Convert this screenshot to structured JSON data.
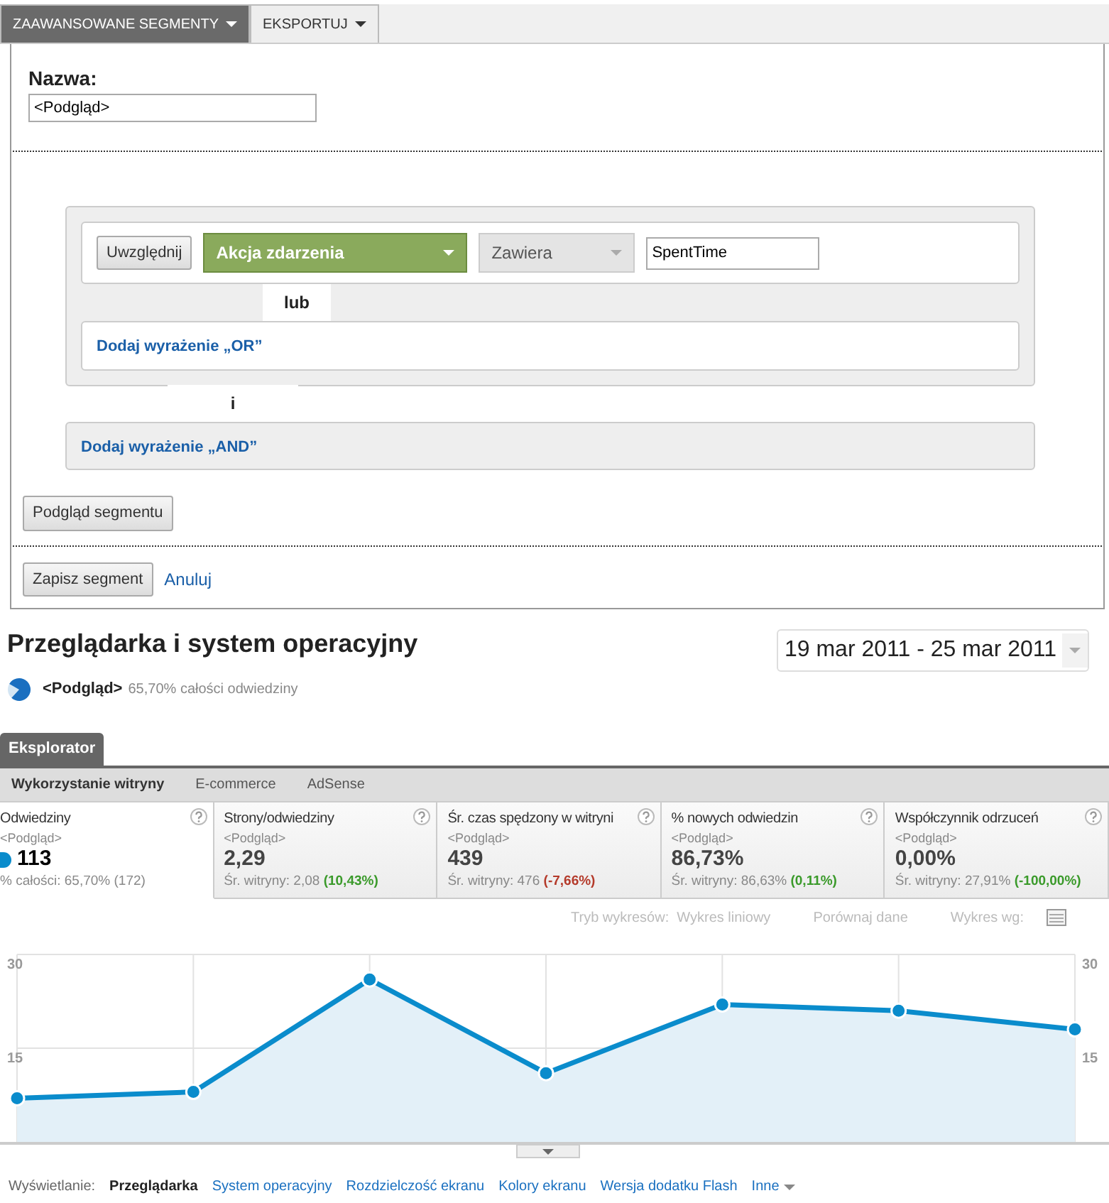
{
  "top_tabs": [
    {
      "label": "ZAAWANSOWANE SEGMENTY",
      "selected": true
    },
    {
      "label": "EKSPORTUJ",
      "selected": false
    }
  ],
  "segment_editor": {
    "name_label": "Nazwa:",
    "name_value": "<Podgląd>",
    "condition": {
      "include_button": "Uwzględnij",
      "dimension": "Akcja zdarzenia",
      "operator": "Zawiera",
      "value": "SpentTime"
    },
    "or_tab": "lub",
    "add_or": "Dodaj wyrażenie „OR”",
    "and_tab": "i",
    "add_and": "Dodaj wyrażenie „AND”",
    "preview_button": "Podgląd segmentu",
    "save_button": "Zapisz segment",
    "cancel_link": "Anuluj"
  },
  "report": {
    "title": "Przeglądarka i system operacyjny",
    "date_range": "19 mar 2011 - 25 mar 2011",
    "segment_name": "<Podgląd>",
    "segment_share": "65,70% całości odwiedziny"
  },
  "explorer_tab": "Eksplorator",
  "sub_tabs": [
    {
      "label": "Wykorzystanie witryny",
      "selected": true
    },
    {
      "label": "E-commerce",
      "selected": false
    },
    {
      "label": "AdSense",
      "selected": false
    }
  ],
  "metrics": [
    {
      "title": "Odwiedziny",
      "segment": "<Podgląd>",
      "value": "113",
      "footer": "% całości: 65,70% (172)",
      "selected": true
    },
    {
      "title": "Strony/odwiedziny",
      "segment": "<Podgląd>",
      "value": "2,29",
      "footer": "Śr. witryny: 2,08",
      "change": {
        "text": "(10,43%)",
        "color": "#3a9a2a"
      },
      "selected": false
    },
    {
      "title": "Śr. czas spędzony w witryni",
      "segment": "<Podgląd>",
      "value": "439",
      "footer": "Śr. witryny: 476",
      "change": {
        "text": "(-7,66%)",
        "color": "#b43a2a"
      },
      "selected": false
    },
    {
      "title": "% nowych odwiedzin",
      "segment": "<Podgląd>",
      "value": "86,73%",
      "footer": "Śr. witryny: 86,63%",
      "change": {
        "text": "(0,11%)",
        "color": "#3a9a2a"
      },
      "selected": false
    },
    {
      "title": "Współczynnik odrzuceń",
      "segment": "<Podgląd>",
      "value": "0,00%",
      "footer": "Śr. witryny: 27,91%",
      "change": {
        "text": "(-100,00%)",
        "color": "#3a9a2a"
      },
      "selected": false
    }
  ],
  "chart_options": {
    "mode_label": "Tryb wykresów:",
    "mode_value": "Wykres liniowy",
    "compare": "Porównaj dane",
    "by_label": "Wykres wg:"
  },
  "chart": {
    "chart_data": {
      "type": "area",
      "ylim": [
        0,
        30
      ],
      "yticks": [
        15,
        30
      ],
      "y2ticks": [
        15,
        30
      ],
      "y2lim": [
        0,
        30
      ],
      "grid": true,
      "series": [
        {
          "color": "#0a8ccc",
          "values": [
            7,
            8,
            26,
            11,
            22,
            21,
            18
          ]
        }
      ]
    }
  },
  "view_links": {
    "label": "Wyświetlanie:",
    "items": [
      {
        "label": "Przeglądarka",
        "selected": true
      },
      {
        "label": "System operacyjny",
        "selected": false
      },
      {
        "label": "Rozdzielczość ekranu",
        "selected": false
      },
      {
        "label": "Kolory ekranu",
        "selected": false
      },
      {
        "label": "Wersja dodatku Flash",
        "selected": false
      },
      {
        "label": "Inne",
        "selected": false
      }
    ]
  }
}
